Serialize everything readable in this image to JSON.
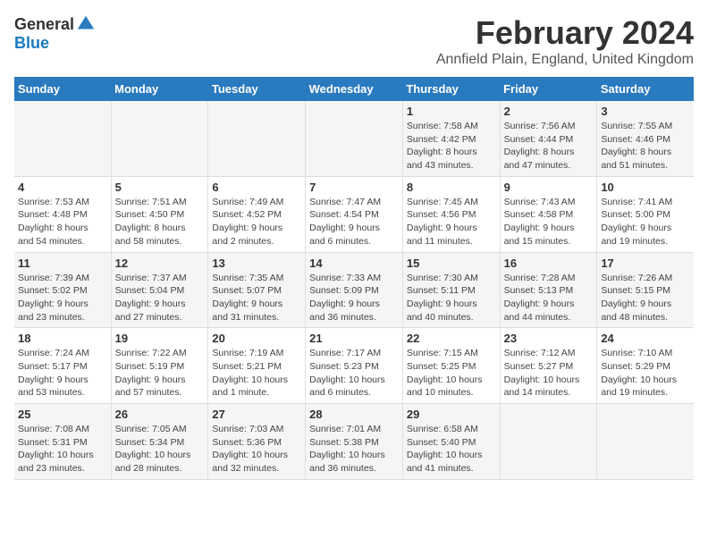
{
  "header": {
    "logo_general": "General",
    "logo_blue": "Blue",
    "title": "February 2024",
    "subtitle": "Annfield Plain, England, United Kingdom"
  },
  "calendar": {
    "days_of_week": [
      "Sunday",
      "Monday",
      "Tuesday",
      "Wednesday",
      "Thursday",
      "Friday",
      "Saturday"
    ],
    "weeks": [
      [
        {
          "day": "",
          "info": ""
        },
        {
          "day": "",
          "info": ""
        },
        {
          "day": "",
          "info": ""
        },
        {
          "day": "",
          "info": ""
        },
        {
          "day": "1",
          "info": "Sunrise: 7:58 AM\nSunset: 4:42 PM\nDaylight: 8 hours\nand 43 minutes."
        },
        {
          "day": "2",
          "info": "Sunrise: 7:56 AM\nSunset: 4:44 PM\nDaylight: 8 hours\nand 47 minutes."
        },
        {
          "day": "3",
          "info": "Sunrise: 7:55 AM\nSunset: 4:46 PM\nDaylight: 8 hours\nand 51 minutes."
        }
      ],
      [
        {
          "day": "4",
          "info": "Sunrise: 7:53 AM\nSunset: 4:48 PM\nDaylight: 8 hours\nand 54 minutes."
        },
        {
          "day": "5",
          "info": "Sunrise: 7:51 AM\nSunset: 4:50 PM\nDaylight: 8 hours\nand 58 minutes."
        },
        {
          "day": "6",
          "info": "Sunrise: 7:49 AM\nSunset: 4:52 PM\nDaylight: 9 hours\nand 2 minutes."
        },
        {
          "day": "7",
          "info": "Sunrise: 7:47 AM\nSunset: 4:54 PM\nDaylight: 9 hours\nand 6 minutes."
        },
        {
          "day": "8",
          "info": "Sunrise: 7:45 AM\nSunset: 4:56 PM\nDaylight: 9 hours\nand 11 minutes."
        },
        {
          "day": "9",
          "info": "Sunrise: 7:43 AM\nSunset: 4:58 PM\nDaylight: 9 hours\nand 15 minutes."
        },
        {
          "day": "10",
          "info": "Sunrise: 7:41 AM\nSunset: 5:00 PM\nDaylight: 9 hours\nand 19 minutes."
        }
      ],
      [
        {
          "day": "11",
          "info": "Sunrise: 7:39 AM\nSunset: 5:02 PM\nDaylight: 9 hours\nand 23 minutes."
        },
        {
          "day": "12",
          "info": "Sunrise: 7:37 AM\nSunset: 5:04 PM\nDaylight: 9 hours\nand 27 minutes."
        },
        {
          "day": "13",
          "info": "Sunrise: 7:35 AM\nSunset: 5:07 PM\nDaylight: 9 hours\nand 31 minutes."
        },
        {
          "day": "14",
          "info": "Sunrise: 7:33 AM\nSunset: 5:09 PM\nDaylight: 9 hours\nand 36 minutes."
        },
        {
          "day": "15",
          "info": "Sunrise: 7:30 AM\nSunset: 5:11 PM\nDaylight: 9 hours\nand 40 minutes."
        },
        {
          "day": "16",
          "info": "Sunrise: 7:28 AM\nSunset: 5:13 PM\nDaylight: 9 hours\nand 44 minutes."
        },
        {
          "day": "17",
          "info": "Sunrise: 7:26 AM\nSunset: 5:15 PM\nDaylight: 9 hours\nand 48 minutes."
        }
      ],
      [
        {
          "day": "18",
          "info": "Sunrise: 7:24 AM\nSunset: 5:17 PM\nDaylight: 9 hours\nand 53 minutes."
        },
        {
          "day": "19",
          "info": "Sunrise: 7:22 AM\nSunset: 5:19 PM\nDaylight: 9 hours\nand 57 minutes."
        },
        {
          "day": "20",
          "info": "Sunrise: 7:19 AM\nSunset: 5:21 PM\nDaylight: 10 hours\nand 1 minute."
        },
        {
          "day": "21",
          "info": "Sunrise: 7:17 AM\nSunset: 5:23 PM\nDaylight: 10 hours\nand 6 minutes."
        },
        {
          "day": "22",
          "info": "Sunrise: 7:15 AM\nSunset: 5:25 PM\nDaylight: 10 hours\nand 10 minutes."
        },
        {
          "day": "23",
          "info": "Sunrise: 7:12 AM\nSunset: 5:27 PM\nDaylight: 10 hours\nand 14 minutes."
        },
        {
          "day": "24",
          "info": "Sunrise: 7:10 AM\nSunset: 5:29 PM\nDaylight: 10 hours\nand 19 minutes."
        }
      ],
      [
        {
          "day": "25",
          "info": "Sunrise: 7:08 AM\nSunset: 5:31 PM\nDaylight: 10 hours\nand 23 minutes."
        },
        {
          "day": "26",
          "info": "Sunrise: 7:05 AM\nSunset: 5:34 PM\nDaylight: 10 hours\nand 28 minutes."
        },
        {
          "day": "27",
          "info": "Sunrise: 7:03 AM\nSunset: 5:36 PM\nDaylight: 10 hours\nand 32 minutes."
        },
        {
          "day": "28",
          "info": "Sunrise: 7:01 AM\nSunset: 5:38 PM\nDaylight: 10 hours\nand 36 minutes."
        },
        {
          "day": "29",
          "info": "Sunrise: 6:58 AM\nSunset: 5:40 PM\nDaylight: 10 hours\nand 41 minutes."
        },
        {
          "day": "",
          "info": ""
        },
        {
          "day": "",
          "info": ""
        }
      ]
    ]
  }
}
